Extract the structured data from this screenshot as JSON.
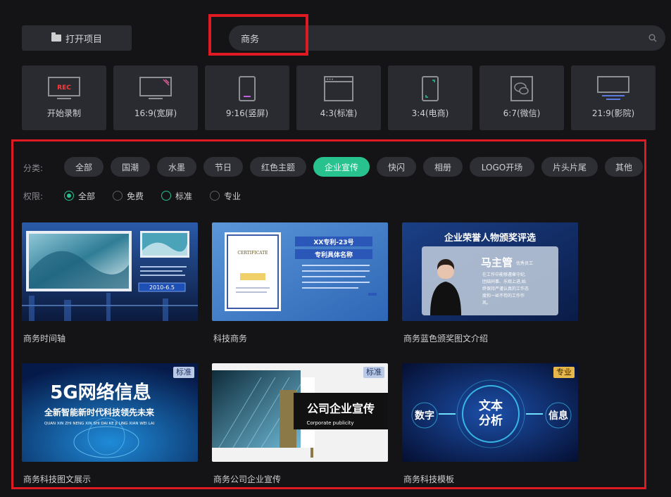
{
  "toolbar": {
    "open_project_label": "打开项目"
  },
  "search": {
    "value": "商务"
  },
  "aspects": [
    {
      "label": "开始录制",
      "icon": "rec-monitor-icon",
      "rec": "REC"
    },
    {
      "label": "16:9(宽屏)",
      "icon": "widescreen-monitor-icon"
    },
    {
      "label": "9:16(竖屏)",
      "icon": "portrait-phone-icon"
    },
    {
      "label": "4:3(标准)",
      "icon": "standard-window-icon"
    },
    {
      "label": "3:4(电商)",
      "icon": "ecommerce-phone-icon"
    },
    {
      "label": "6:7(微信)",
      "icon": "wechat-icon"
    },
    {
      "label": "21:9(影院)",
      "icon": "cinema-screen-icon"
    }
  ],
  "filters": {
    "category_label": "分类:",
    "categories": [
      "全部",
      "国潮",
      "水墨",
      "节日",
      "红色主题",
      "企业宣传",
      "快闪",
      "相册",
      "LOGO开场",
      "片头片尾",
      "其他"
    ],
    "active_category": "企业宣传",
    "permission_label": "权限:",
    "permissions": [
      "全部",
      "免费",
      "标准",
      "专业"
    ],
    "selected_permission": "全部"
  },
  "templates": [
    {
      "title": "商务时间轴",
      "badge": "",
      "date": "2010-6.5"
    },
    {
      "title": "科技商务",
      "badge": "",
      "cert_title": "CERTIFICATE",
      "heading1": "XX专利-23号",
      "heading2": "专利具体名称"
    },
    {
      "title": "商务蓝色颁奖图文介绍",
      "badge": "",
      "heading": "企业荣誉人物颁奖评选",
      "name": "马主管",
      "role": "优秀员工",
      "desc": [
        "在工作中能够遵章守纪,",
        "团结同事、乐观上进,始",
        "终保持严谨认真的工作态",
        "度和一丝不苟的工作作",
        "风。"
      ]
    },
    {
      "title": "商务科技图文展示",
      "badge": "标准",
      "heading": "5G网络信息",
      "sub": "全新智能新时代科技领先未来",
      "pinyin": "QUAN XIN ZHI NENG XIN SHI DAI KE JI LING XIAN WEI LAI"
    },
    {
      "title": "商务公司企业宣传",
      "badge": "标准",
      "heading": "公司企业宣传",
      "sub": "Corporate publicity"
    },
    {
      "title": "商务科技模板",
      "badge": "专业",
      "left": "数字",
      "center1": "文本",
      "center2": "分析",
      "right": "信息"
    }
  ],
  "colors": {
    "accent": "#27c28d",
    "highlight": "#e01a22",
    "badge_standard": "#b9c9e6",
    "badge_pro": "#e6b74a"
  }
}
